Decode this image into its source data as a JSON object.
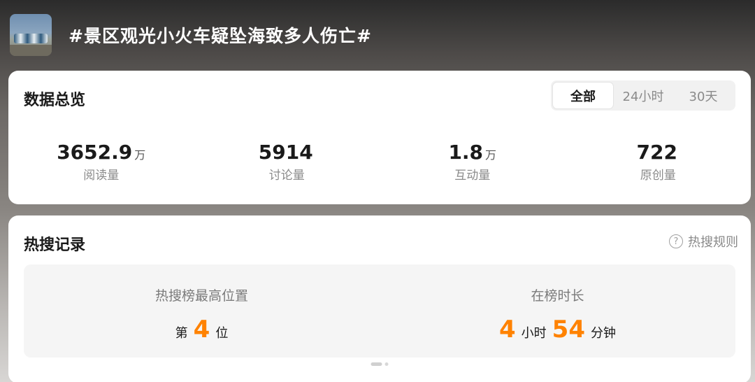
{
  "header": {
    "title": "#景区观光小火车疑坠海致多人伤亡#",
    "thumbnail": "train-photo"
  },
  "overview": {
    "title": "数据总览",
    "tabs": [
      "全部",
      "24小时",
      "30天"
    ],
    "active_tab": "全部",
    "stats": [
      {
        "value": "3652.9",
        "unit": "万",
        "label": "阅读量"
      },
      {
        "value": "5914",
        "unit": "",
        "label": "讨论量"
      },
      {
        "value": "1.8",
        "unit": "万",
        "label": "互动量"
      },
      {
        "value": "722",
        "unit": "",
        "label": "原创量"
      }
    ]
  },
  "hot": {
    "title": "热搜记录",
    "rules_label": "热搜规则",
    "peak": {
      "label": "热搜榜最高位置",
      "prefix": "第",
      "rank": "4",
      "suffix": "位"
    },
    "duration": {
      "label": "在榜时长",
      "hours": "4",
      "hours_unit": "小时",
      "minutes": "54",
      "minutes_unit": "分钟"
    }
  },
  "colors": {
    "accent": "#ff8200",
    "card": "#ffffff",
    "panel": "#f5f5f5"
  }
}
